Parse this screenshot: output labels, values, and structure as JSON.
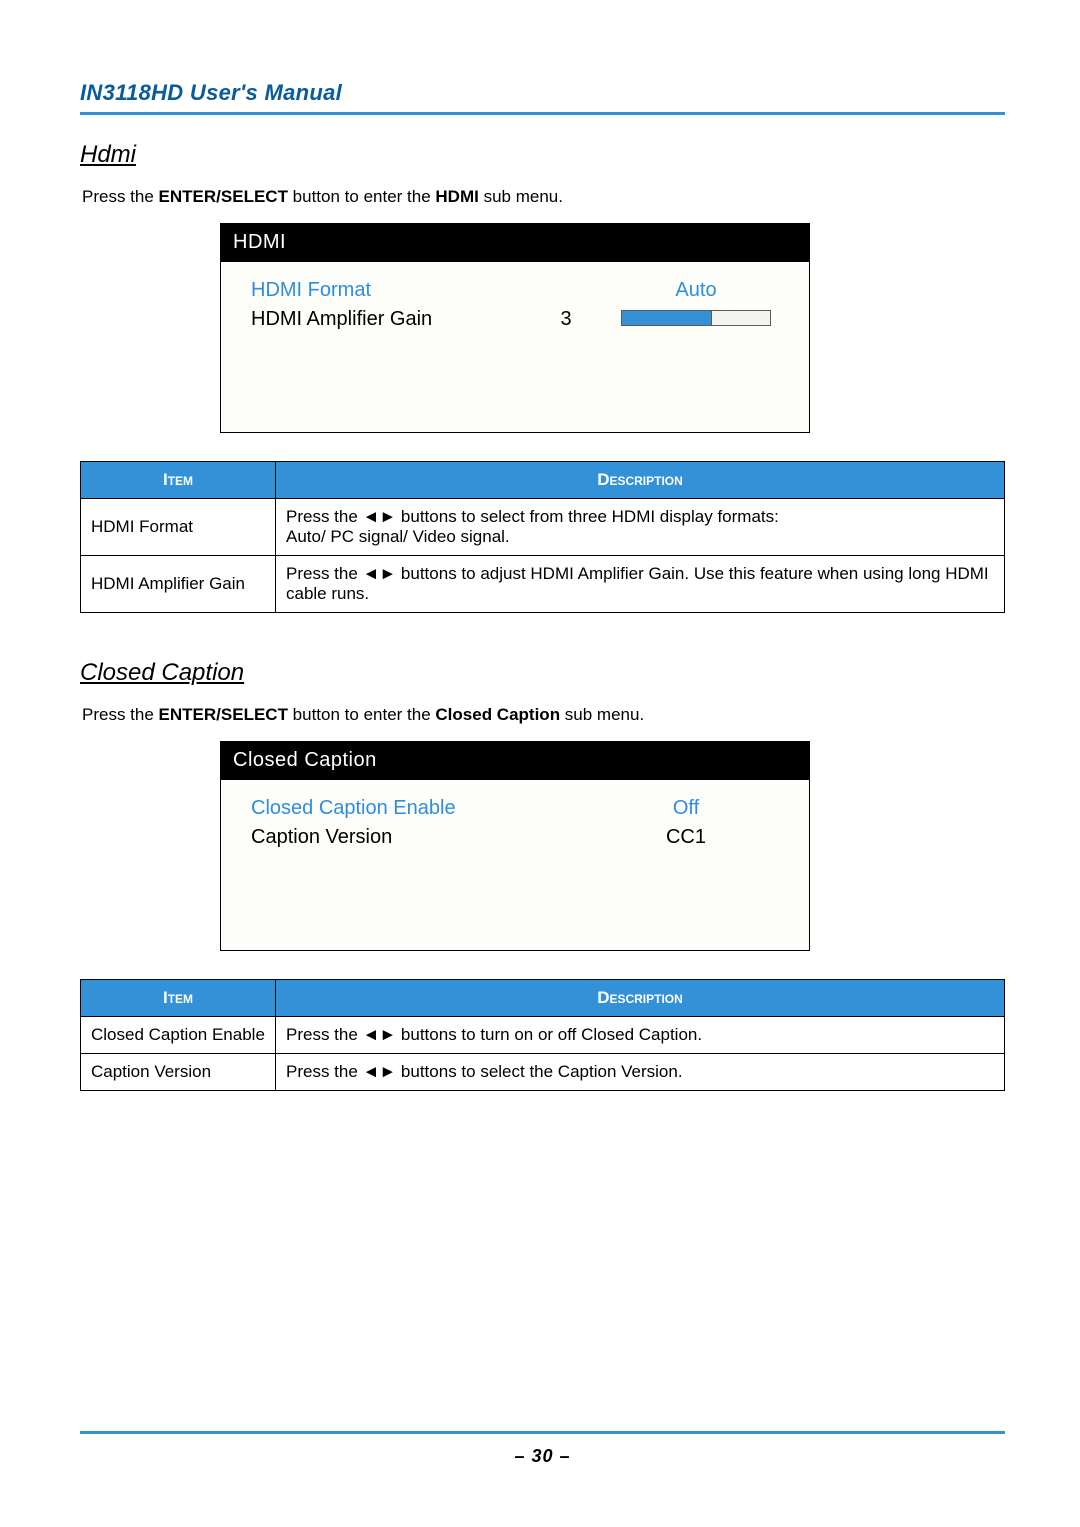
{
  "header": {
    "title": "IN3118HD User's Manual"
  },
  "sections": {
    "hdmi": {
      "heading": "Hdmi",
      "intro_pre": "Press the ",
      "intro_enter": "ENTER/SELECT",
      "intro_mid": " button to enter the ",
      "intro_sub": "HDMI",
      "intro_post": " sub menu.",
      "menu": {
        "title": "HDMI",
        "rows": [
          {
            "label": "HDMI Format",
            "value": "Auto",
            "highlight": true
          },
          {
            "label": "HDMI Amplifier Gain",
            "num": "3",
            "slider_fill_pct": 60
          }
        ]
      },
      "table": {
        "head_item": "Item",
        "head_desc": "Description",
        "rows": [
          {
            "item": "HDMI Format",
            "desc_pre": "Press the ",
            "desc_arrows": "◄►",
            "desc_post": " buttons to select from three HDMI display formats:\nAuto/ PC signal/ Video signal."
          },
          {
            "item": "HDMI Amplifier Gain",
            "desc_pre": "Press the ",
            "desc_arrows": "◄►",
            "desc_post": " buttons to adjust HDMI Amplifier Gain. Use this feature when using long HDMI cable runs."
          }
        ]
      }
    },
    "cc": {
      "heading": "Closed Caption",
      "intro_pre": "Press the ",
      "intro_enter": "ENTER/SELECT",
      "intro_mid": " button to enter the ",
      "intro_sub": "Closed Caption",
      "intro_post": " sub menu.",
      "menu": {
        "title": "Closed Caption",
        "rows": [
          {
            "label": "Closed Caption Enable",
            "value": "Off",
            "highlight": true
          },
          {
            "label": "Caption Version",
            "value": "CC1"
          }
        ]
      },
      "table": {
        "head_item": "Item",
        "head_desc": "Description",
        "rows": [
          {
            "item": "Closed Caption Enable",
            "desc_pre": "Press the ",
            "desc_arrows": "◄►",
            "desc_post": " buttons to turn on or off Closed Caption."
          },
          {
            "item": "Caption Version",
            "desc_pre": "Press the ",
            "desc_arrows": "◄►",
            "desc_post": " buttons to select the Caption Version."
          }
        ]
      }
    }
  },
  "footer": {
    "page": "– 30 –"
  }
}
